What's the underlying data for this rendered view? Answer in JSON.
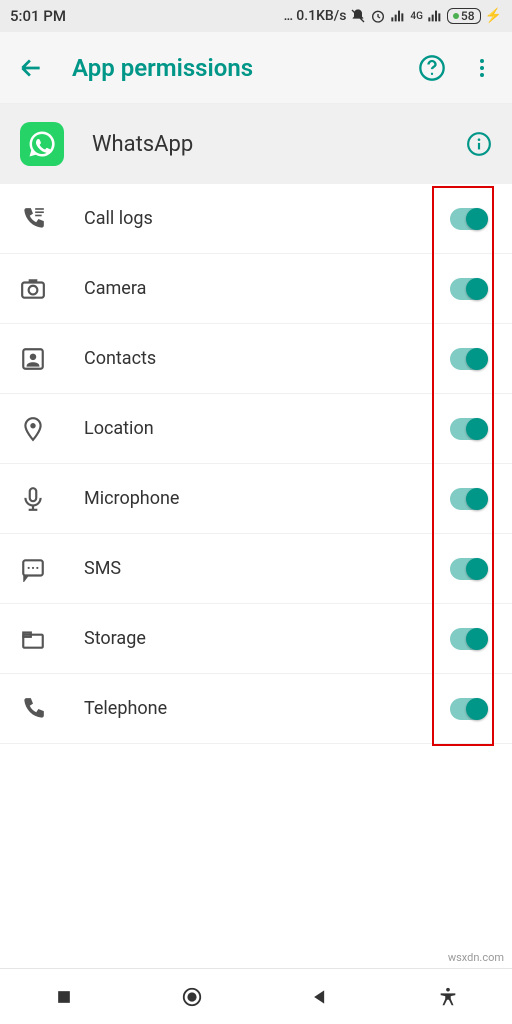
{
  "status": {
    "time": "5:01 PM",
    "net": "0.1KB/s",
    "battery": "58"
  },
  "toolbar": {
    "title": "App permissions"
  },
  "app": {
    "name": "WhatsApp"
  },
  "permissions": [
    {
      "label": "Call logs",
      "icon": "calllogs",
      "on": true
    },
    {
      "label": "Camera",
      "icon": "camera",
      "on": true
    },
    {
      "label": "Contacts",
      "icon": "contacts",
      "on": true
    },
    {
      "label": "Location",
      "icon": "location",
      "on": true
    },
    {
      "label": "Microphone",
      "icon": "microphone",
      "on": true
    },
    {
      "label": "SMS",
      "icon": "sms",
      "on": true
    },
    {
      "label": "Storage",
      "icon": "storage",
      "on": true
    },
    {
      "label": "Telephone",
      "icon": "telephone",
      "on": true
    }
  ],
  "watermark": "wsxdn.com"
}
